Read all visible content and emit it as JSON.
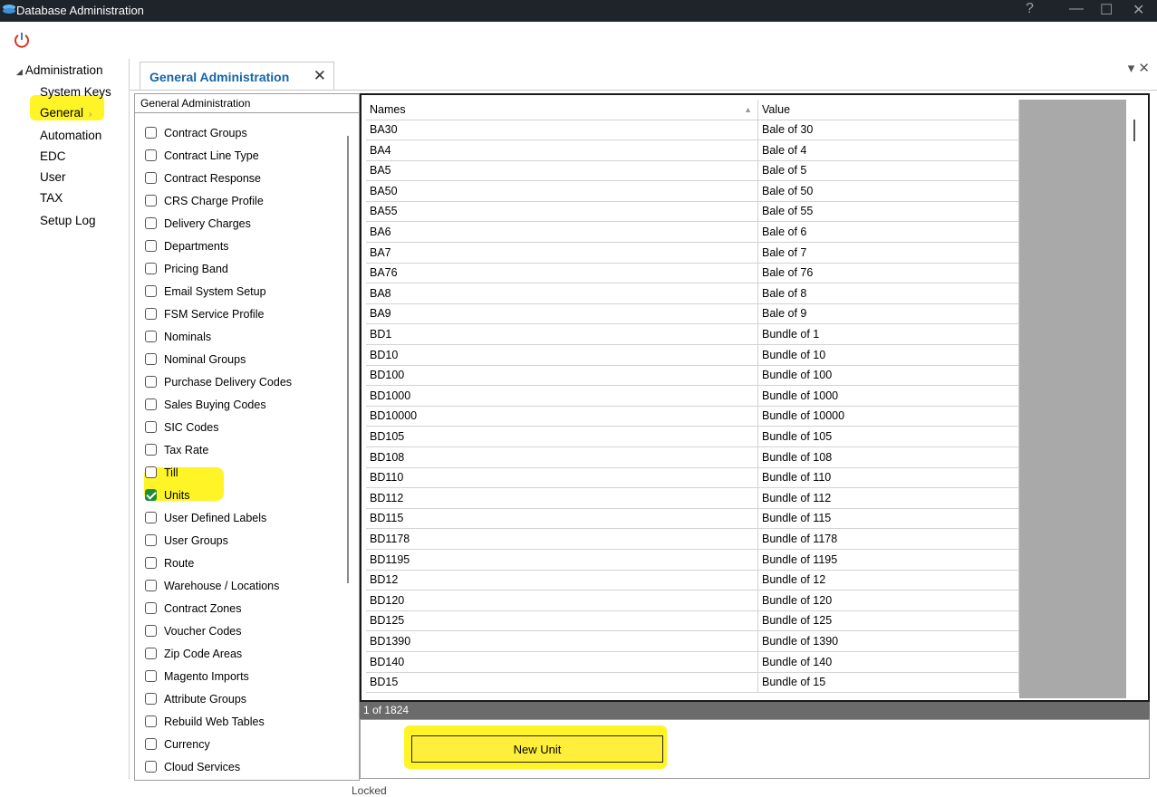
{
  "window": {
    "title": "Database Administration",
    "help": "?",
    "minimize": "—",
    "maximize": "☐",
    "close": "✕"
  },
  "nav": {
    "root_label": "Administration",
    "items": [
      "System Keys",
      "General",
      "Automation",
      "EDC",
      "User",
      "TAX",
      "Setup Log"
    ],
    "selected": "General"
  },
  "tab": {
    "label": "General Administration",
    "close": "✕"
  },
  "pane_controls": "▾ ✕",
  "tree": {
    "header": "General Administration",
    "items": [
      {
        "label": "Contract Groups",
        "checked": false
      },
      {
        "label": "Contract Line Type",
        "checked": false
      },
      {
        "label": "Contract Response",
        "checked": false
      },
      {
        "label": "CRS Charge Profile",
        "checked": false
      },
      {
        "label": "Delivery Charges",
        "checked": false
      },
      {
        "label": "Departments",
        "checked": false
      },
      {
        "label": "Pricing Band",
        "checked": false
      },
      {
        "label": "Email System Setup",
        "checked": false
      },
      {
        "label": "FSM Service Profile",
        "checked": false
      },
      {
        "label": "Nominals",
        "checked": false
      },
      {
        "label": "Nominal Groups",
        "checked": false
      },
      {
        "label": "Purchase Delivery Codes",
        "checked": false
      },
      {
        "label": "Sales Buying Codes",
        "checked": false
      },
      {
        "label": "SIC Codes",
        "checked": false
      },
      {
        "label": "Tax Rate",
        "checked": false
      },
      {
        "label": "Till",
        "checked": false
      },
      {
        "label": "Units",
        "checked": true
      },
      {
        "label": "User Defined Labels",
        "checked": false
      },
      {
        "label": "User Groups",
        "checked": false
      },
      {
        "label": "Route",
        "checked": false
      },
      {
        "label": "Warehouse / Locations",
        "checked": false
      },
      {
        "label": "Contract Zones",
        "checked": false
      },
      {
        "label": "Voucher Codes",
        "checked": false
      },
      {
        "label": "Zip Code Areas",
        "checked": false
      },
      {
        "label": "Magento Imports",
        "checked": false
      },
      {
        "label": "Attribute Groups",
        "checked": false
      },
      {
        "label": "Rebuild Web Tables",
        "checked": false
      },
      {
        "label": "Currency",
        "checked": false
      },
      {
        "label": "Cloud Services",
        "checked": false
      }
    ]
  },
  "grid": {
    "columns": [
      "Names",
      "Value"
    ],
    "sort_indicator": "▲",
    "rows": [
      [
        "BA30",
        "Bale of 30"
      ],
      [
        "BA4",
        "Bale of 4"
      ],
      [
        "BA5",
        "Bale of 5"
      ],
      [
        "BA50",
        "Bale of 50"
      ],
      [
        "BA55",
        "Bale of 55"
      ],
      [
        "BA6",
        "Bale of 6"
      ],
      [
        "BA7",
        "Bale of 7"
      ],
      [
        "BA76",
        "Bale of 76"
      ],
      [
        "BA8",
        "Bale of 8"
      ],
      [
        "BA9",
        "Bale of 9"
      ],
      [
        "BD1",
        "Bundle of 1"
      ],
      [
        "BD10",
        "Bundle of 10"
      ],
      [
        "BD100",
        "Bundle of 100"
      ],
      [
        "BD1000",
        "Bundle of 1000"
      ],
      [
        "BD10000",
        "Bundle of 10000"
      ],
      [
        "BD105",
        "Bundle of 105"
      ],
      [
        "BD108",
        "Bundle of 108"
      ],
      [
        "BD110",
        "Bundle of 110"
      ],
      [
        "BD112",
        "Bundle of 112"
      ],
      [
        "BD115",
        "Bundle of 115"
      ],
      [
        "BD1178",
        "Bundle of 1178"
      ],
      [
        "BD1195",
        "Bundle of 1195"
      ],
      [
        "BD12",
        "Bundle of 12"
      ],
      [
        "BD120",
        "Bundle of 120"
      ],
      [
        "BD125",
        "Bundle of 125"
      ],
      [
        "BD1390",
        "Bundle of 1390"
      ],
      [
        "BD140",
        "Bundle of 140"
      ],
      [
        "BD15",
        "Bundle of 15"
      ]
    ]
  },
  "status": {
    "record_count": "1 of 1824"
  },
  "actions": {
    "new_unit": "New Unit"
  },
  "footer": {
    "text": "Locked"
  },
  "colors": {
    "highlight": "#fff200",
    "titlebar": "#1f232a",
    "tab_text": "#1565a7",
    "checked": "#1e8c3a"
  }
}
